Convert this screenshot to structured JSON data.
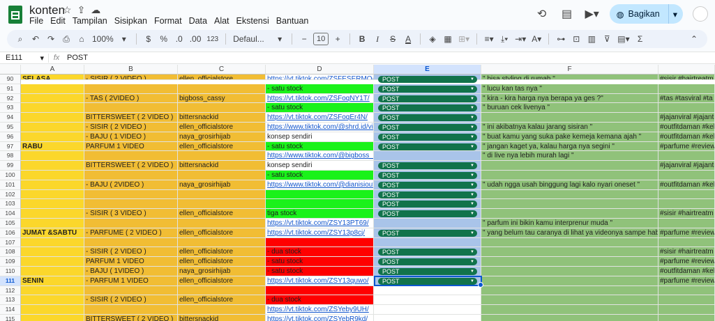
{
  "app": {
    "doc_title": "konten",
    "menu": [
      "File",
      "Edit",
      "Tampilan",
      "Sisipkan",
      "Format",
      "Data",
      "Alat",
      "Ekstensi",
      "Bantuan"
    ],
    "share_label": "Bagikan"
  },
  "toolbar": {
    "zoom": "100%",
    "currency": "$",
    "percent": "%",
    "dec_decrease": ".0",
    "dec_increase": ".00",
    "number_format": "123",
    "font": "Defaul...",
    "font_size": "10",
    "bold": "B",
    "italic": "I",
    "strike": "S",
    "text_color": "A"
  },
  "formula_bar": {
    "cell_ref": "E111",
    "value": "POST"
  },
  "colors": {
    "yellow": "#fbd72b",
    "orange": "#f1bd34",
    "green_bright": "#1af21a",
    "red": "#ff0000",
    "blue_light": "#a9c4e9",
    "green_dull": "#90c27a",
    "chip": "#11734b",
    "selection": "#0b57d0"
  },
  "columns": [
    "A",
    "B",
    "C",
    "D",
    "E",
    "F"
  ],
  "rows": [
    {
      "n": "90",
      "a": "SELASA",
      "b": "- SISIR ( 2 VIDEO )",
      "c": "ellen_officialstore",
      "d": "https://vt.tiktok.com/ZSFESERMO/",
      "d_link": true,
      "e": "POST",
      "f": "\" bisa styling di rumah \"",
      "g": "#sisir #hairtreatm"
    },
    {
      "n": "91",
      "a": "",
      "b": "",
      "c": "",
      "d": "- satu stock",
      "d_color": "green_bright",
      "e": "POST",
      "f": "\" lucu kan tas nya \"",
      "g": ""
    },
    {
      "n": "92",
      "a": "",
      "b": "- TAS  ( 2VIDEO )",
      "c": "bigboss_cassy",
      "d": "https://vt.tiktok.com/ZSFoqNY1T/",
      "d_link": true,
      "e": "POST",
      "f": "\" kira - kira harga nya berapa ya ges ?\"",
      "g": "#tas #tasviral  #ta"
    },
    {
      "n": "93",
      "a": "",
      "b": "",
      "c": "",
      "d": "- satu stock",
      "d_color": "green_bright",
      "e": "POST",
      "f": "\" buruan cek livenya \"",
      "g": ""
    },
    {
      "n": "94",
      "a": "",
      "b": "BITTERSWEET ( 2 VIDEO )",
      "c": "bittersnackid",
      "d": "https://vt.tiktok.com/ZSFoqEr4N/",
      "d_link": true,
      "e": "POST",
      "f": "",
      "g": "#jajanviral #jajanti"
    },
    {
      "n": "95",
      "a": "",
      "b": "- SISIR ( 2 VIDEO )",
      "c": "ellen_officialstore",
      "d": "https://www.tiktok.com/@shrd.id/video/",
      "d_link": true,
      "e": "POST",
      "f": "\" ini akibatnya kalau jarang sisiran \"",
      "g": "#outfitdaman #kek"
    },
    {
      "n": "96",
      "a": "",
      "b": "- BAJU ( 1 VIDEO )",
      "c": "naya_grosirhijab",
      "d": "konsep sendiri",
      "e": "POST",
      "f": "\" buat kamu yang suka pake kemeja kemana ajah \"",
      "g": "#outfitdaman #kek"
    },
    {
      "n": "97",
      "a": "RABU",
      "b": "PARFUM 1 VIDEO",
      "c": "ellen_officialstore",
      "d": "- satu stock",
      "d_color": "green_bright",
      "e": "POST",
      "f": "\" jangan kaget ya, kalau harga nya segini \"",
      "g": "#parfume #review"
    },
    {
      "n": "98",
      "a": "",
      "b": "",
      "c": "",
      "d": "https://www.tiktok.com/@bigboss_cass",
      "d_link": true,
      "e": "",
      "f": "\" di live nya lebih murah lagi \"",
      "g": ""
    },
    {
      "n": "99",
      "a": "",
      "b": "BITTERSWEET ( 2 VIDEO )",
      "c": "bittersnackid",
      "d": "konsep sendiri",
      "e": "POST",
      "f": "",
      "g": "#jajanviral #jajanti"
    },
    {
      "n": "100",
      "a": "",
      "b": "",
      "c": "",
      "d": "- satu stock",
      "d_color": "green_bright",
      "e": "POST",
      "f": "",
      "g": ""
    },
    {
      "n": "101",
      "a": "",
      "b": "- BAJU ( 2VIDEO )",
      "c": "naya_grosirhijab",
      "d": "https://www.tiktok.com/@dianisioutfitid",
      "d_link": true,
      "e": "POST",
      "f": "\" udah ngga usah binggung lagi kalo nyari oneset \"",
      "g": "#outfitdaman #kek"
    },
    {
      "n": "102",
      "a": "",
      "b": "",
      "c": "",
      "d": "",
      "d_color": "green_bright",
      "e": "POST",
      "f": "",
      "g": ""
    },
    {
      "n": "103",
      "a": "",
      "b": "",
      "c": "",
      "d": "",
      "d_color": "green_bright",
      "e": "POST",
      "f": "",
      "g": ""
    },
    {
      "n": "104",
      "a": "",
      "b": "- SISIR ( 3 VIDEO )",
      "c": "ellen_officialstore",
      "d": "tiga stock",
      "d_color": "green_bright",
      "e": "POST",
      "f": "",
      "g": "#sisir #hairtreatm"
    },
    {
      "n": "105",
      "a": "",
      "b": "",
      "c": "",
      "d": "https://vt.tiktok.com/ZSY13PT69/",
      "d_link": true,
      "e": "",
      "f": "\" parfum ini bikin kamu interprenur muda \"",
      "g": ""
    },
    {
      "n": "106",
      "a": "JUMAT &SABTU",
      "b": "- PARFUME ( 2 VIDEO )",
      "c": "ellen_officialstore",
      "d": "https://vt.tiktok.com/ZSY13p8cj/",
      "d_link": true,
      "e": "POST",
      "f": "\" yang belum tau caranya di lihat ya videonya sampe habis \"",
      "g": "#parfume #review"
    },
    {
      "n": "107",
      "a": "",
      "b": "",
      "c": "",
      "d": "",
      "d_color": "red",
      "e": "",
      "f": "",
      "g": ""
    },
    {
      "n": "108",
      "a": "",
      "b": "- SISIR ( 2 VIDEO )",
      "c": "ellen_officialstore",
      "d": "- dua stock",
      "d_color": "red",
      "e": "POST",
      "f": "",
      "g": "#sisir #hairtreatm"
    },
    {
      "n": "109",
      "a": "",
      "b": "PARFUM 1 VIDEO",
      "c": "ellen_officialstore",
      "d": "- satu stock",
      "d_color": "red",
      "e": "POST",
      "f": "",
      "g": "#parfume #review"
    },
    {
      "n": "110",
      "a": "",
      "b": "- BAJU ( 1VIDEO )",
      "c": "naya_grosirhijab",
      "d": "- satu stock",
      "d_color": "red",
      "e": "POST",
      "f": "",
      "g": "#outfitdaman #kek"
    },
    {
      "n": "111",
      "a": "SENIN",
      "b": "- PARFUM 1 VIDEO",
      "c": "ellen_officialstore",
      "d": "https://vt.tiktok.com/ZSY13quwo/",
      "d_link": true,
      "e": "POST",
      "f": "",
      "g": "#parfume #review"
    },
    {
      "n": "112",
      "a": "",
      "b": "",
      "c": "",
      "d": "",
      "d_color": "red",
      "e": "",
      "f": "",
      "g": ""
    },
    {
      "n": "113",
      "a": "",
      "b": "- SISIR ( 2 VIDEO )",
      "c": "ellen_officialstore",
      "d": "- dua stock",
      "d_color": "red",
      "e": "",
      "f": "",
      "g": ""
    },
    {
      "n": "114",
      "a": "",
      "b": "",
      "c": "",
      "d": "https://vt.tiktok.com/ZSYeby9UH/",
      "d_link": true,
      "e": "",
      "f": "",
      "g": ""
    },
    {
      "n": "115",
      "a": "",
      "b": "BITTERSWEET ( 2 VIDEO )",
      "c": "bittersnackid",
      "d": "https://vt.tiktok.com/ZSYebR9kd/",
      "d_link": true,
      "e": "",
      "f": "",
      "g": ""
    }
  ]
}
